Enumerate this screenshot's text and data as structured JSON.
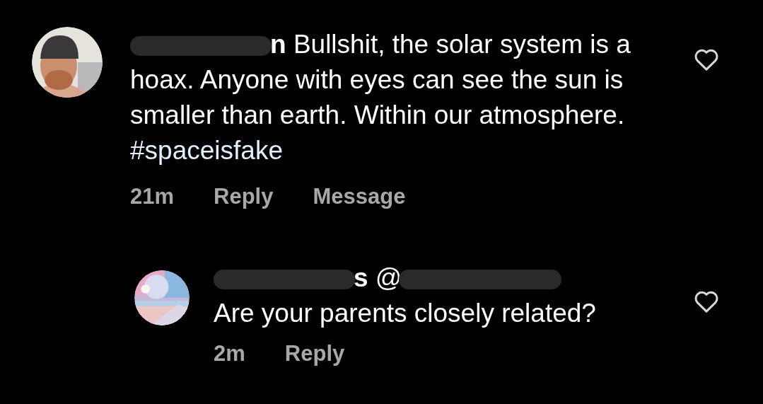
{
  "comments": [
    {
      "kind": "comment",
      "avatar": {
        "kind": "picture"
      },
      "username_visible": "n",
      "username_redacted": true,
      "text": "Bullshit, the solar system is a hoax. Anyone with eyes can see the sun is smaller than earth. Within our atmosphere.",
      "hashtag": "#spaceisfake",
      "time": "21m",
      "actions": [
        "Reply",
        "Message"
      ],
      "liked": false
    },
    {
      "kind": "reply",
      "avatar": {
        "kind": "picture"
      },
      "username_visible": "s",
      "username_redacted": true,
      "mention_visible": "@",
      "mention_redacted": true,
      "text": "Are your parents closely related?",
      "time": "2m",
      "actions": [
        "Reply"
      ],
      "liked": false
    }
  ]
}
